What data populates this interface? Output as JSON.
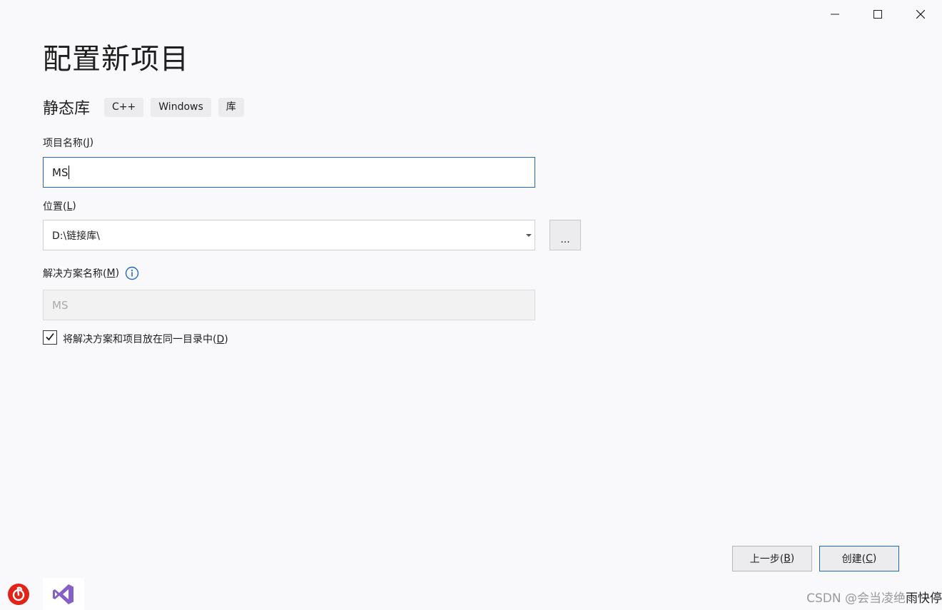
{
  "window_controls": {
    "minimize_icon": "minimize-icon",
    "maximize_icon": "maximize-icon",
    "close_icon": "close-icon"
  },
  "page": {
    "title": "配置新项目",
    "template_name": "静态库",
    "tags": [
      "C++",
      "Windows",
      "库"
    ]
  },
  "project_name": {
    "label": "项目名称(",
    "accel": "J",
    "label_end": ")",
    "value": "MS"
  },
  "location": {
    "label": "位置(",
    "accel": "L",
    "label_end": ")",
    "value": "D:\\链接库\\",
    "browse_label": "..."
  },
  "solution_name": {
    "label": "解决方案名称(",
    "accel": "M",
    "label_end": ")",
    "value": "MS",
    "info_icon": "info-icon"
  },
  "same_dir_checkbox": {
    "checked": true,
    "label": "将解决方案和项目放在同一目录中(",
    "accel": "D",
    "label_end": ")"
  },
  "buttons": {
    "back_label": "上一步(",
    "back_accel": "B",
    "back_end": ")",
    "create_label": "创建(",
    "create_accel": "C",
    "create_end": ")"
  },
  "taskbar": {
    "apps": [
      "netease-music-icon",
      "visual-studio-icon"
    ]
  },
  "watermark": {
    "text": "CSDN @会当凌绝",
    "overflow_text": "雨快停"
  },
  "colors": {
    "accent": "#1f6ab8",
    "background": "#f9f9fb",
    "netease_red": "#e2231a",
    "vs_purple": "#8661c5"
  }
}
